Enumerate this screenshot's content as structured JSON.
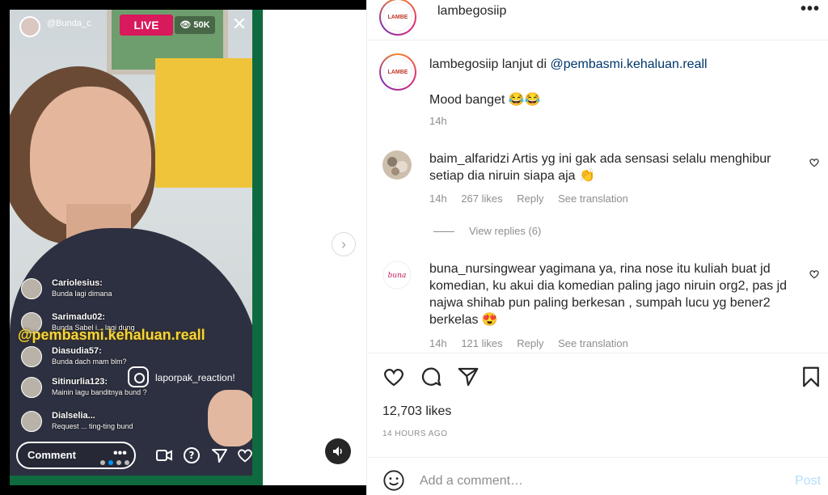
{
  "media": {
    "live_username": "@Bunda_c",
    "live_badge": "LIVE",
    "viewer_count": "50K",
    "close_glyph": "✕",
    "chat": [
      {
        "name": "Cariolesius:",
        "text": "Bunda lagi dimana"
      },
      {
        "name": "Sarimadu02:",
        "text": "Bunda Sabel i... lagi dung"
      },
      {
        "name": "Diasudia57:",
        "text": "Bunda dach mam blm?"
      },
      {
        "name": "Sitinurlia123:",
        "text": "Mainin lagu banditnya bund ?"
      },
      {
        "name": "Dialselia...",
        "text": "Request ... ting-ting bund"
      }
    ],
    "watermark": "@pembasmi.kehaluan.reall",
    "ig_handle": "laporpak_reaction!",
    "comment_placeholder": "Comment",
    "more_glyph": "•••",
    "next_glyph": "›",
    "sound_icon": "speaker-icon"
  },
  "post": {
    "username": "lambegosiip",
    "menu_glyph": "•••",
    "logo_text": "LAMBE",
    "caption": {
      "username": "lambegosiip",
      "prefix": "lanjut di",
      "mention": "@pembasmi.kehaluan.reall",
      "text": "Mood banget 😂😂",
      "time": "14h"
    },
    "comments": [
      {
        "username": "baim_alfaridzi",
        "text": "Artis yg ini gak ada sensasi selalu menghibur setiap dia niruin siapa aja 👏",
        "time": "14h",
        "likes": "267 likes",
        "reply": "Reply",
        "translate": "See translation"
      },
      {
        "username": "buna_nursingwear",
        "text": "yagimana ya, rina nose itu kuliah buat jd komedian, ku akui dia komedian paling jago niruin org2, pas jd najwa shihab pun paling berkesan , sumpah lucu yg bener2 berkelas 😍",
        "time": "14h",
        "likes": "121 likes",
        "reply": "Reply",
        "translate": "See translation"
      }
    ],
    "view_replies": "View replies (6)",
    "likes_total": "12,703 likes",
    "posted_ago": "14 HOURS AGO",
    "add_comment_placeholder": "Add a comment…",
    "post_button": "Post"
  },
  "colors": {
    "accent": "#0095f6",
    "live_red": "#d8195b",
    "watermark_yellow": "#f7d53a",
    "muted": "#8e8e8e",
    "link": "#00376b"
  }
}
